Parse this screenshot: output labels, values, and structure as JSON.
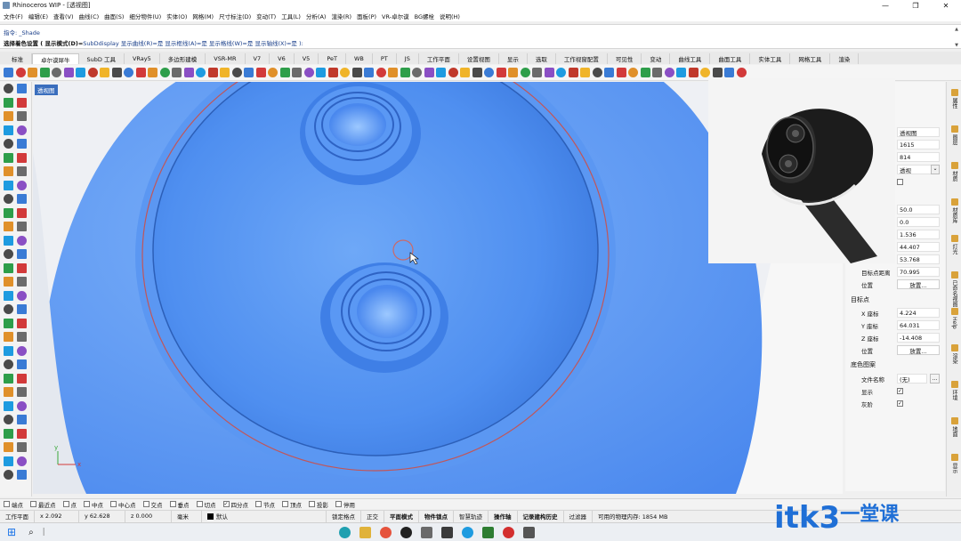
{
  "window": {
    "title": "Rhinoceros WIP - [透视图]",
    "controls": [
      "—",
      "❐",
      "✕"
    ]
  },
  "menu": [
    "文件(F)",
    "编辑(E)",
    "查看(V)",
    "曲线(C)",
    "曲面(S)",
    "细分物件(U)",
    "实体(O)",
    "网格(M)",
    "尺寸标注(D)",
    "变动(T)",
    "工具(L)",
    "分析(A)",
    "渲染(R)",
    "面板(P)",
    "VR-卓尔谟",
    "BG螺栓",
    "说明(H)"
  ],
  "command": {
    "history": "指令: _Shade",
    "prompt_prefix": "选择着色设置 ( 显示模式(D)=",
    "prompt_rest": "SubDdisplay  显示曲线(R)=是  显示框线(A)=是  显示格线(W)=是  显示轴线(X)=是 ):"
  },
  "tabs": [
    "标准",
    "卓尔谟犀牛",
    "SubD 工具",
    "VRay5",
    "多边形建模",
    "VSR-MR",
    "V7",
    "V6",
    "V5",
    "PeT",
    "WB",
    "PT",
    "JS",
    "工作平面",
    "设置视图",
    "显示",
    "选取",
    "工作视窗配置",
    "可见性",
    "变动",
    "曲线工具",
    "曲面工具",
    "实体工具",
    "网格工具",
    "渲染"
  ],
  "active_tab": "卓尔谟犀牛",
  "viewport": {
    "label": "透视图",
    "axis_y": "y",
    "axis_x": "x"
  },
  "properties": {
    "top_values": [
      {
        "label": "",
        "value": "透视图"
      },
      {
        "label": "",
        "value": "1615"
      },
      {
        "label": "",
        "value": "814"
      },
      {
        "label": "",
        "value": "透视"
      },
      {
        "label": "",
        "value": ""
      },
      {
        "label": "",
        "value": "50.0"
      },
      {
        "label": "",
        "value": "0.0"
      },
      {
        "label": "",
        "value": "1.536"
      },
      {
        "label": "",
        "value": "44.407"
      },
      {
        "label": "",
        "value": "53.768"
      }
    ],
    "target_distance_label": "目标点距离",
    "target_distance": "70.995",
    "position_label": "位置",
    "place_button": "放置...",
    "target_section": "目标点",
    "x_label": "X 座标",
    "x_value": "4.224",
    "y_label": "Y 座标",
    "y_value": "64.031",
    "z_label": "Z 座标",
    "z_value": "-14.408",
    "target_position_label": "位置",
    "target_place_button": "放置...",
    "bg_section": "底色图案",
    "file_label": "文件名称",
    "file_value": "(无)",
    "file_browse": "...",
    "show_label": "显示",
    "gray_label": "灰阶"
  },
  "right_panel_tabs": [
    "属性",
    "图层",
    "材质",
    "材质库",
    "灯光",
    "已命名视图",
    "Help",
    "渲染",
    "环境",
    "地面",
    "显示"
  ],
  "osnap": [
    {
      "label": "端点",
      "checked": false
    },
    {
      "label": "最近点",
      "checked": false
    },
    {
      "label": "点",
      "checked": false
    },
    {
      "label": "中点",
      "checked": false
    },
    {
      "label": "中心点",
      "checked": false
    },
    {
      "label": "交点",
      "checked": false
    },
    {
      "label": "垂点",
      "checked": false
    },
    {
      "label": "切点",
      "checked": false
    },
    {
      "label": "四分点",
      "checked": true
    },
    {
      "label": "节点",
      "checked": false
    },
    {
      "label": "顶点",
      "checked": false
    },
    {
      "label": "投影",
      "checked": false
    },
    {
      "label": "停用",
      "checked": false
    }
  ],
  "status": {
    "plane": "工作平面",
    "x": "x 2.092",
    "y": "y 62.628",
    "z": "z 0.000",
    "unit": "毫米",
    "layer": "默认",
    "toggles": [
      "锁定格点",
      "正交",
      "平面模式",
      "物件锁点",
      "智慧轨迹",
      "操作轴",
      "记录建构历史",
      "过滤器"
    ],
    "memory": "可用的物理内存: 1854 MB"
  },
  "watermark": {
    "latin": "itk3",
    "cn": "一堂课"
  },
  "colors": {
    "model": "#4f8ff0",
    "accent": "#3a6ebd"
  }
}
